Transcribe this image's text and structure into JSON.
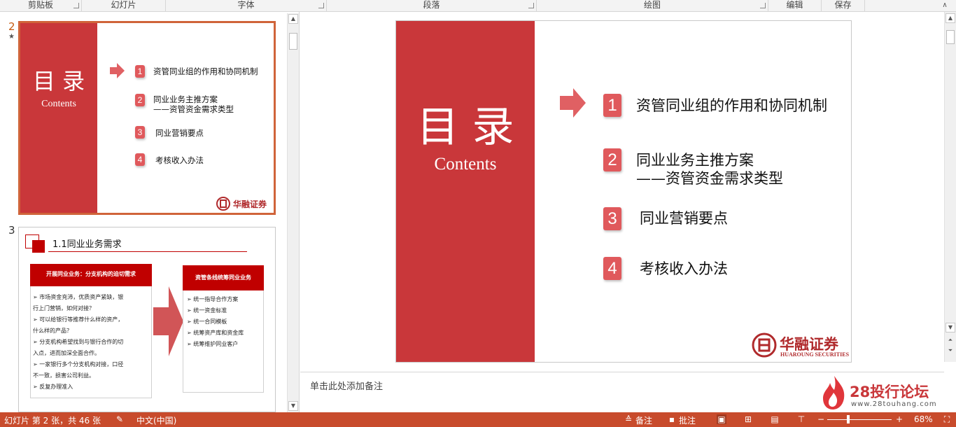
{
  "ribbon": {
    "groups": [
      "剪贴板",
      "幻灯片",
      "字体",
      "段落",
      "绘图",
      "编辑",
      "保存"
    ]
  },
  "thumbnails": {
    "slide2": {
      "number": "2",
      "star": "★",
      "title": "目 录",
      "subtitle": "Contents",
      "items": [
        {
          "num": "1",
          "text": "资管同业组的作用和协同机制"
        },
        {
          "num": "2",
          "text": "同业业务主推方案",
          "text2": "——资管资金需求类型"
        },
        {
          "num": "3",
          "text": "同业营销要点"
        },
        {
          "num": "4",
          "text": "考核收入办法"
        }
      ],
      "logo": "华融证券"
    },
    "slide3": {
      "number": "3",
      "title": "1.1同业业务需求",
      "left_header": "开展同业业务：分支机构的迫切需求",
      "left_lines": [
        "➢  市场资金充沛，优质资产紧缺，银",
        "    行上门营销，如何对接？",
        "➢  可以给银行等推荐什么样的资产，",
        "    什么样的产品？",
        "➢  分支机构希望找到与银行合作的切",
        "    入点，进而加深全面合作。",
        "➢  一家银行多个分支机构对接，口径",
        "    不一致，损害公司利益。",
        "➢  反复办理准入"
      ],
      "right_header": "资管条线统筹同业业务",
      "right_lines": [
        "➢  统一指导合作方案",
        "➢  统一资金标准",
        "➢  统一合同模板",
        "➢  统筹资产库和资金库",
        "➢  统筹维护同业客户"
      ]
    }
  },
  "main_slide": {
    "title": "目 录",
    "subtitle": "Contents",
    "items": [
      {
        "num": "1",
        "text": "资管同业组的作用和协同机制"
      },
      {
        "num": "2",
        "text": "同业业务主推方案",
        "text2": "——资管资金需求类型"
      },
      {
        "num": "3",
        "text": "同业营销要点"
      },
      {
        "num": "4",
        "text": "考核收入办法"
      }
    ],
    "logo": "华融证券",
    "logo_sub": "HUAROUNG SECURITIES"
  },
  "notes": {
    "placeholder": "单击此处添加备注"
  },
  "watermark": {
    "brand": "28投行论坛",
    "url": "www.28touhang.com"
  },
  "status": {
    "slide_info": "幻灯片 第 2 张，共 46 张",
    "language": "中文(中国)",
    "notes_label": "备注",
    "comments_label": "批注",
    "zoom": "68%"
  },
  "colors": {
    "accent_red": "#c9373a",
    "badge": "#e0595c",
    "status_bar": "#c84b2c"
  }
}
